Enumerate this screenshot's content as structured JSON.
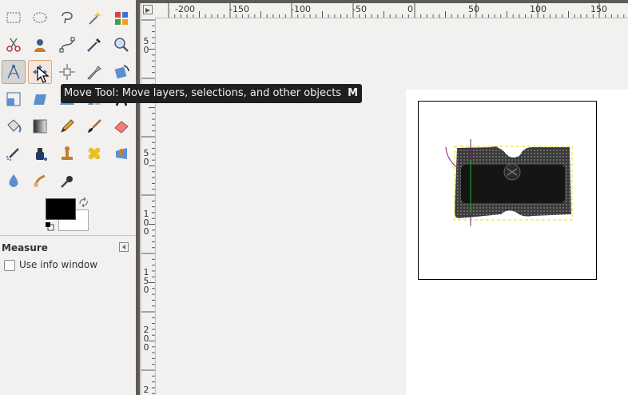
{
  "tooltip": {
    "text": "Move Tool: Move layers, selections, and other objects",
    "shortcut": "M"
  },
  "tool_options": {
    "title": "Measure",
    "use_info_window": "Use info window",
    "use_info_window_checked": false
  },
  "colors": {
    "foreground": "#000000",
    "background": "#ffffff",
    "accent": "#d9a87a"
  },
  "ruler": {
    "h_labels": [
      "-200",
      "-150",
      "-100",
      "-50",
      "0",
      "50",
      "100",
      "150"
    ],
    "v_labels": [
      "5 0",
      "5 0",
      "1 0 0",
      "1 5 0",
      "2 0 0",
      "2"
    ]
  },
  "tools": [
    {
      "name": "rect-select-icon"
    },
    {
      "name": "ellipse-select-icon"
    },
    {
      "name": "free-select-icon"
    },
    {
      "name": "fuzzy-select-icon"
    },
    {
      "name": "select-by-color-icon"
    },
    {
      "name": "scissors-select-icon"
    },
    {
      "name": "foreground-select-icon"
    },
    {
      "name": "paths-icon"
    },
    {
      "name": "color-picker-icon"
    },
    {
      "name": "zoom-icon"
    },
    {
      "name": "measure-icon"
    },
    {
      "name": "move-icon"
    },
    {
      "name": "align-icon"
    },
    {
      "name": "crop-icon"
    },
    {
      "name": "rotate-icon"
    },
    {
      "name": "scale-icon"
    },
    {
      "name": "shear-icon"
    },
    {
      "name": "perspective-icon"
    },
    {
      "name": "flip-icon"
    },
    {
      "name": "text-icon"
    },
    {
      "name": "bucket-fill-icon"
    },
    {
      "name": "blend-icon"
    },
    {
      "name": "pencil-icon"
    },
    {
      "name": "paintbrush-icon"
    },
    {
      "name": "eraser-icon"
    },
    {
      "name": "airbrush-icon"
    },
    {
      "name": "ink-icon"
    },
    {
      "name": "clone-icon"
    },
    {
      "name": "heal-icon"
    },
    {
      "name": "perspective-clone-icon"
    },
    {
      "name": "blur-icon"
    },
    {
      "name": "smudge-icon"
    },
    {
      "name": "dodge-burn-icon"
    }
  ]
}
